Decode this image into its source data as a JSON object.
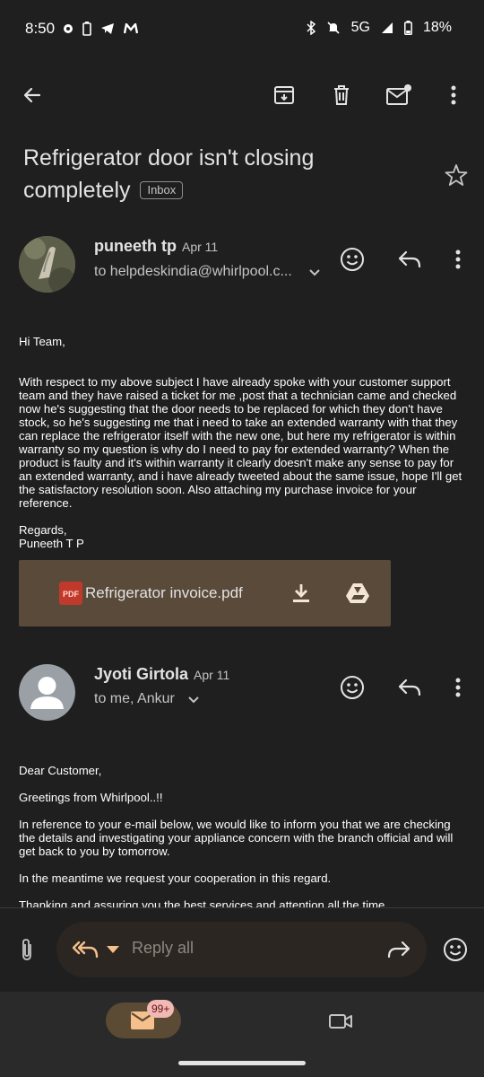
{
  "status_bar": {
    "time": "8:50",
    "network": "5G",
    "battery": "18%"
  },
  "toolbar": {
    "icons": [
      "back-arrow-icon",
      "archive-icon",
      "delete-icon",
      "mark-unread-icon",
      "more-vert-icon"
    ]
  },
  "subject": {
    "line1": "Refrigerator door isn't closing",
    "line2": "completely",
    "label": "Inbox"
  },
  "messages": [
    {
      "sender": "puneeth tp",
      "date": "Apr 11",
      "recipients": "to helpdeskindia@whirlpool.c...",
      "body": [
        "Hi Team,",
        "With respect to my above subject I have already spoke with your customer support team and they have raised a ticket for me ,post that a technician came and checked now he's suggesting that the door needs to be replaced for which they don't have stock, so he's suggesting me that i need to take an extended warranty with that they can replace the refrigerator itself with the new one, but here my refrigerator is within warranty so my question is why do I need to pay for extended warranty? When the product is faulty and it's within warranty it clearly doesn't make any sense to pay for an extended warranty, and i have already tweeted about the same issue, hope I'll get the satisfactory resolution soon. Also attaching my purchase invoice for your reference.",
        "Regards,",
        "Puneeth T P"
      ],
      "attachment": {
        "type_label": "PDF",
        "name": "Refrigerator invoice.pdf"
      }
    },
    {
      "sender": "Jyoti Girtola",
      "date": "Apr 11",
      "recipients": "to me, Ankur",
      "body": [
        "Dear Customer,",
        "Greetings from Whirlpool..!!",
        "In reference to your e-mail below, we would like to inform you that we are checking the details and investigating your appliance concern with the branch official and will get back to you by tomorrow.",
        "In the meantime we request your cooperation in this regard.",
        "Thanking and assuring you the best services and attention all the time"
      ]
    }
  ],
  "reply_bar": {
    "placeholder": "Reply all"
  },
  "bottom_nav": {
    "mail_badge": "99+"
  },
  "colors": {
    "background": "#1f1f1f",
    "attachment": "#5a4a3a",
    "accent": "#f6c08c",
    "badge": "#f2b8b5"
  }
}
